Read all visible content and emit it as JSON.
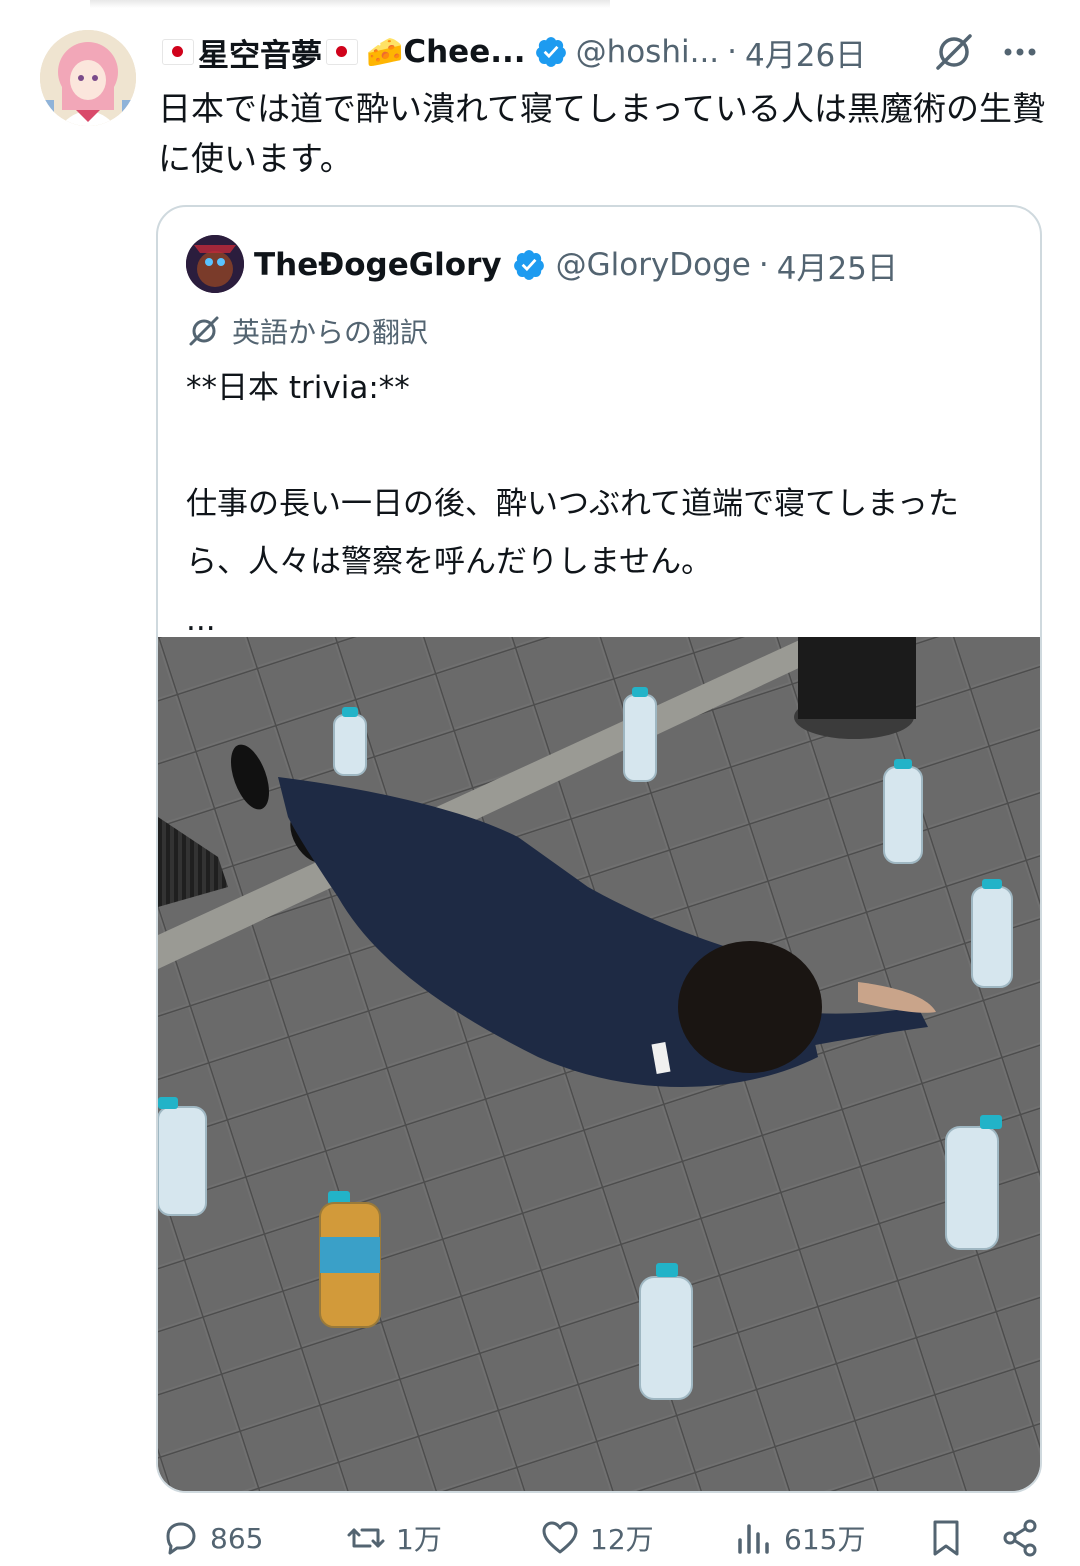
{
  "tweet": {
    "display_name": "星空音夢",
    "name_suffix": "Chee...",
    "handle": "@hoshi...",
    "separator": "·",
    "date": "4月26日",
    "text": "日本では道で酔い潰れて寝てしまっている人は黒魔術の生贄に使います。"
  },
  "quote": {
    "display_name": "TheĐogeGlory",
    "handle": "@GloryDoge",
    "separator": "·",
    "date": "4月25日",
    "translation_label": "英語からの翻訳",
    "line1": "**日本 trivia:**",
    "line2": "仕事の長い一日の後、酔いつぶれて道端で寝てしまったら、人々は警察を呼んだりしません。",
    "ellipsis": "..."
  },
  "actions": {
    "replies": "865",
    "reposts": "1万",
    "likes": "12万",
    "views": "615万"
  },
  "icons": {
    "verified": "verified-badge-icon",
    "grok": "grok-icon",
    "more": "more-icon",
    "reply": "reply-icon",
    "repost": "repost-icon",
    "like": "heart-icon",
    "views": "views-icon",
    "bookmark": "bookmark-icon",
    "share": "share-icon"
  },
  "colors": {
    "verified": "#1d9bf0",
    "muted_text": "#536471",
    "border": "#cfd9de"
  }
}
